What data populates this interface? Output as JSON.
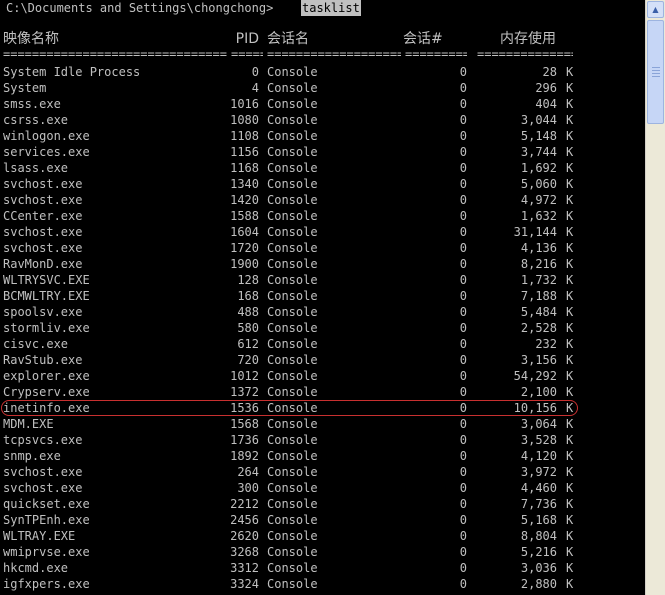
{
  "prompt": {
    "path": "C:\\Documents and Settings\\chongchong>",
    "command": "tasklist"
  },
  "header": {
    "image_name": "映像名称",
    "pid": "PID",
    "session_name": "会话名",
    "session_num": "会话#",
    "mem_usage": "内存使用"
  },
  "rows": [
    [
      "System Idle Process",
      "0",
      "Console",
      "0",
      "28",
      "K"
    ],
    [
      "System",
      "4",
      "Console",
      "0",
      "296",
      "K"
    ],
    [
      "smss.exe",
      "1016",
      "Console",
      "0",
      "404",
      "K"
    ],
    [
      "csrss.exe",
      "1080",
      "Console",
      "0",
      "3,044",
      "K"
    ],
    [
      "winlogon.exe",
      "1108",
      "Console",
      "0",
      "5,148",
      "K"
    ],
    [
      "services.exe",
      "1156",
      "Console",
      "0",
      "3,744",
      "K"
    ],
    [
      "lsass.exe",
      "1168",
      "Console",
      "0",
      "1,692",
      "K"
    ],
    [
      "svchost.exe",
      "1340",
      "Console",
      "0",
      "5,060",
      "K"
    ],
    [
      "svchost.exe",
      "1420",
      "Console",
      "0",
      "4,972",
      "K"
    ],
    [
      "CCenter.exe",
      "1588",
      "Console",
      "0",
      "1,632",
      "K"
    ],
    [
      "svchost.exe",
      "1604",
      "Console",
      "0",
      "31,144",
      "K"
    ],
    [
      "svchost.exe",
      "1720",
      "Console",
      "0",
      "4,136",
      "K"
    ],
    [
      "RavMonD.exe",
      "1900",
      "Console",
      "0",
      "8,216",
      "K"
    ],
    [
      "WLTRYSVC.EXE",
      "128",
      "Console",
      "0",
      "1,732",
      "K"
    ],
    [
      "BCMWLTRY.EXE",
      "168",
      "Console",
      "0",
      "7,188",
      "K"
    ],
    [
      "spoolsv.exe",
      "488",
      "Console",
      "0",
      "5,484",
      "K"
    ],
    [
      "stormliv.exe",
      "580",
      "Console",
      "0",
      "2,528",
      "K"
    ],
    [
      "cisvc.exe",
      "612",
      "Console",
      "0",
      "232",
      "K"
    ],
    [
      "RavStub.exe",
      "720",
      "Console",
      "0",
      "3,156",
      "K"
    ],
    [
      "explorer.exe",
      "1012",
      "Console",
      "0",
      "54,292",
      "K"
    ],
    [
      "Crypserv.exe",
      "1372",
      "Console",
      "0",
      "2,100",
      "K"
    ],
    [
      "inetinfo.exe",
      "1536",
      "Console",
      "0",
      "10,156",
      "K"
    ],
    [
      "MDM.EXE",
      "1568",
      "Console",
      "0",
      "3,064",
      "K"
    ],
    [
      "tcpsvcs.exe",
      "1736",
      "Console",
      "0",
      "3,528",
      "K"
    ],
    [
      "snmp.exe",
      "1892",
      "Console",
      "0",
      "4,120",
      "K"
    ],
    [
      "svchost.exe",
      "264",
      "Console",
      "0",
      "3,972",
      "K"
    ],
    [
      "svchost.exe",
      "300",
      "Console",
      "0",
      "4,460",
      "K"
    ],
    [
      "quickset.exe",
      "2212",
      "Console",
      "0",
      "7,736",
      "K"
    ],
    [
      "SynTPEnh.exe",
      "2456",
      "Console",
      "0",
      "5,168",
      "K"
    ],
    [
      "WLTRAY.EXE",
      "2620",
      "Console",
      "0",
      "8,804",
      "K"
    ],
    [
      "wmiprvse.exe",
      "3268",
      "Console",
      "0",
      "5,216",
      "K"
    ],
    [
      "hkcmd.exe",
      "3312",
      "Console",
      "0",
      "3,036",
      "K"
    ],
    [
      "igfxpers.exe",
      "3324",
      "Console",
      "0",
      "2,880",
      "K"
    ]
  ],
  "highlighted_row": "inetinfo.exe",
  "scrollbar": {
    "up_arrow_icon": "triangle-up-icon",
    "thumb": "scroll-thumb"
  },
  "colors": {
    "console_bg": "#000000",
    "console_text": "#c0c0c0",
    "highlight_circle": "#c83030",
    "scrollbar_track": "#ece9d8"
  }
}
